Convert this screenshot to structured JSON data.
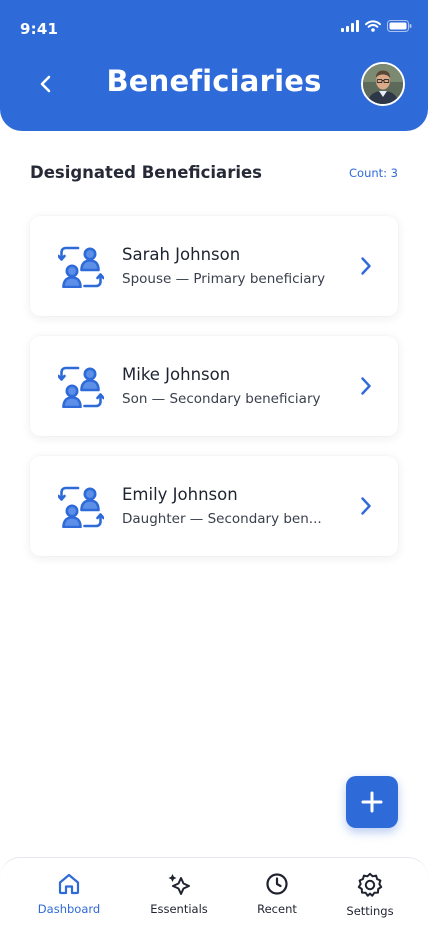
{
  "status_bar": {
    "time": "9:41"
  },
  "header": {
    "title": "Beneficiaries"
  },
  "section": {
    "title": "Designated Beneficiaries",
    "count": "Count: 3"
  },
  "beneficiaries": [
    {
      "name": "Sarah Johnson",
      "relation": "Spouse — Primary beneficiary"
    },
    {
      "name": "Mike Johnson",
      "relation": "Son — Secondary beneficiary"
    },
    {
      "name": "Emily Johnson",
      "relation": "Daughter — Secondary ben..."
    }
  ],
  "nav": {
    "items": [
      {
        "label": "Dashboard",
        "icon": "home-icon",
        "active": true
      },
      {
        "label": "Essentials",
        "icon": "sparkle-icon",
        "active": false
      },
      {
        "label": "Recent",
        "icon": "clock-icon",
        "active": false
      },
      {
        "label": "Settings",
        "icon": "gear-icon",
        "active": false
      }
    ]
  },
  "colors": {
    "accent": "#2f6ad9",
    "background": "#ffffff",
    "text": "#1f2330"
  }
}
